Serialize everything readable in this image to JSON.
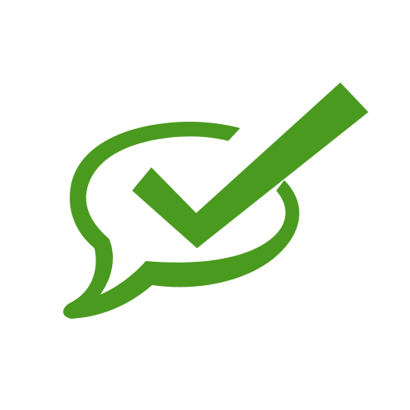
{
  "icon": {
    "name": "speech-bubble-checkmark-icon",
    "color": "#4a9a1f",
    "background": "#ffffff"
  }
}
